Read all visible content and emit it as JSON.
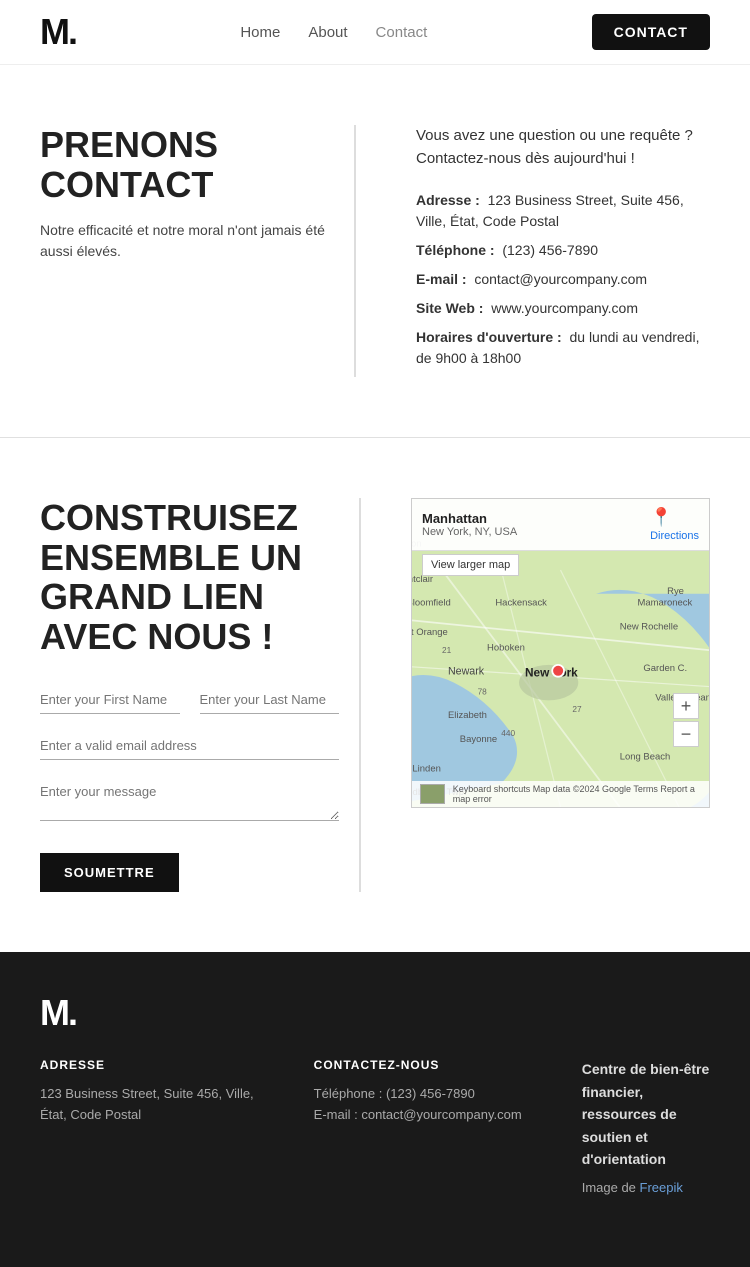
{
  "header": {
    "logo": "M.",
    "nav": [
      {
        "label": "Home",
        "active": false
      },
      {
        "label": "About",
        "active": false
      },
      {
        "label": "Contact",
        "active": true
      }
    ],
    "contact_btn": "CONTACT"
  },
  "section1": {
    "heading": "PRENONS CONTACT",
    "subtext": "Notre efficacité et notre moral n'ont jamais été aussi élevés.",
    "intro": "Vous avez une question ou une requête ? Contactez-nous dès aujourd'hui !",
    "address_label": "Adresse :",
    "address_value": "123 Business Street, Suite 456, Ville, État, Code Postal",
    "phone_label": "Téléphone :",
    "phone_value": "(123) 456-7890",
    "email_label": "E-mail :",
    "email_value": "contact@yourcompany.com",
    "web_label": "Site Web :",
    "web_value": "www.yourcompany.com",
    "hours_label": "Horaires d'ouverture :",
    "hours_value": "du lundi au vendredi, de 9h00 à 18h00"
  },
  "section2": {
    "heading": "CONSTRUISEZ ENSEMBLE UN GRAND LIEN AVEC NOUS !",
    "form": {
      "first_name_placeholder": "Enter your First Name",
      "last_name_placeholder": "Enter your Last Name",
      "email_placeholder": "Enter a valid email address",
      "message_placeholder": "Enter your message",
      "submit_label": "SOUMETTRE"
    },
    "map": {
      "title": "Manhattan",
      "subtitle": "New York, NY, USA",
      "directions_link": "Directions",
      "larger_link": "View larger map",
      "labels": {
        "nyc": "New York",
        "newark": "Newark",
        "hoboken": "Hoboken",
        "hackensack": "Hackensack",
        "bayonne": "Bayonne",
        "elizabeth": "Elizabeth"
      },
      "footer_text": "Keyboard shortcuts   Map data ©2024 Google   Terms   Report a map error",
      "zoom_in": "+",
      "zoom_out": "−"
    }
  },
  "footer": {
    "logo": "M.",
    "address": {
      "heading": "ADRESSE",
      "line1": "123 Business Street, Suite 456, Ville,",
      "line2": "État, Code Postal"
    },
    "contact": {
      "heading": "CONTACTEZ-NOUS",
      "phone": "Téléphone : (123) 456-7890",
      "email": "E-mail : contact@yourcompany.com"
    },
    "credits": {
      "text": "Centre de bien-être financier, ressources de soutien et d'orientation",
      "image_label": "Image de ",
      "image_link": "Freepik"
    }
  }
}
